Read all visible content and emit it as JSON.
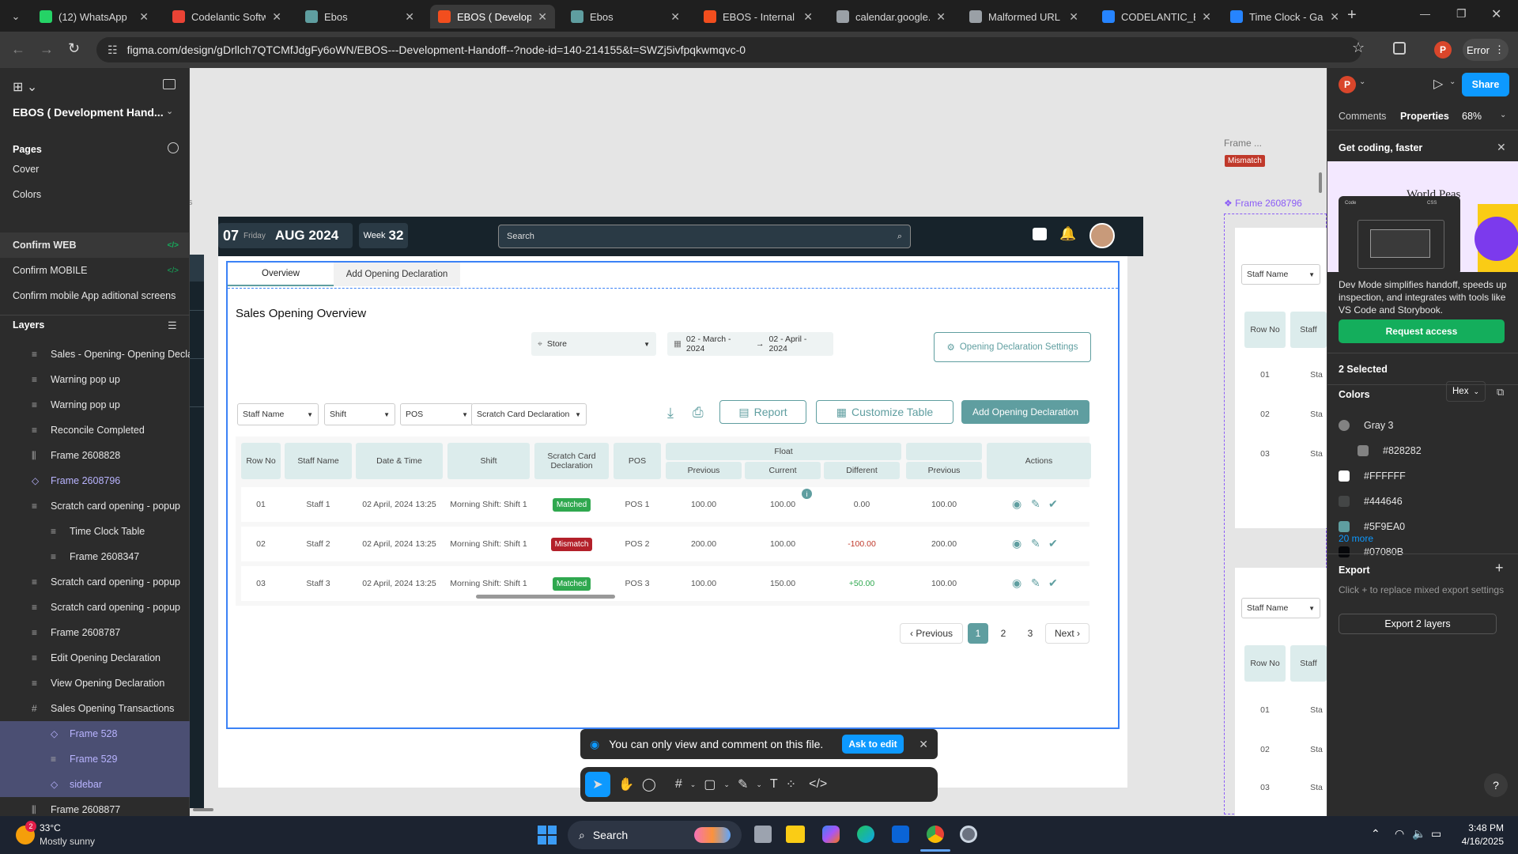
{
  "browser": {
    "tabs": [
      {
        "label": "(12) WhatsApp",
        "color": "#25d366"
      },
      {
        "label": "Codelantic Softw",
        "color": "#ea4335"
      },
      {
        "label": "Ebos",
        "color": "#5f9ea0"
      },
      {
        "label": "EBOS ( Developm",
        "color": "#f24e1e",
        "active": true
      },
      {
        "label": "Ebos",
        "color": "#5f9ea0"
      },
      {
        "label": "EBOS - Internal W",
        "color": "#f24e1e"
      },
      {
        "label": "calendar.google.c",
        "color": "#9aa0a6"
      },
      {
        "label": "Malformed URL E",
        "color": "#9aa0a6"
      },
      {
        "label": "CODELANTIC_EBC",
        "color": "#2684ff"
      },
      {
        "label": "Time Clock - Galle",
        "color": "#2684ff"
      }
    ],
    "url": "figma.com/design/gDrllch7QTCMfJdgFy6oWN/EBOS---Development-Handoff--?node-id=140-214155&t=SWZj5ivfpqkwmqvc-0",
    "profile_letter": "P",
    "error_label": "Error"
  },
  "figma": {
    "file_name": "EBOS ( Development Hand...",
    "pages_title": "Pages",
    "pages": [
      "Cover",
      "Colors",
      "Confirm WEB",
      "Confirm  MOBILE",
      "Confirm mobile App aditional screens"
    ],
    "layers_title": "Layers",
    "layers": [
      {
        "label": "Sales - Opening- Opening Declara",
        "icon": "frame",
        "indent": 0
      },
      {
        "label": "Warning pop up",
        "icon": "frame",
        "indent": 0
      },
      {
        "label": "Warning pop up",
        "icon": "frame",
        "indent": 0
      },
      {
        "label": "Reconcile Completed",
        "icon": "frame",
        "indent": 0
      },
      {
        "label": "Frame 2608828",
        "icon": "columns",
        "indent": 0
      },
      {
        "label": "Frame 2608796",
        "icon": "component",
        "indent": 0,
        "purple": true
      },
      {
        "label": "Scratch card opening - popup",
        "icon": "frame",
        "indent": 0
      },
      {
        "label": "Time Clock Table",
        "icon": "frame",
        "indent": 1
      },
      {
        "label": "Frame 2608347",
        "icon": "frame",
        "indent": 1
      },
      {
        "label": "Scratch card opening - popup",
        "icon": "frame",
        "indent": 0
      },
      {
        "label": "Scratch card opening - popup",
        "icon": "frame",
        "indent": 0
      },
      {
        "label": "Frame 2608787",
        "icon": "frame",
        "indent": 0
      },
      {
        "label": "Edit Opening Declaration",
        "icon": "frame",
        "indent": 0
      },
      {
        "label": "View Opening Declaration",
        "icon": "frame",
        "indent": 0
      },
      {
        "label": "Sales Opening Transactions",
        "icon": "hash",
        "indent": 0
      },
      {
        "label": "Frame 528",
        "icon": "component",
        "indent": 1,
        "selected": true
      },
      {
        "label": "Frame 529",
        "icon": "frame",
        "indent": 1,
        "selected": true
      },
      {
        "label": "sidebar",
        "icon": "component",
        "indent": 1,
        "selected": true
      },
      {
        "label": "Frame 2608877",
        "icon": "columns",
        "indent": 0
      }
    ],
    "canvas": {
      "frame_label_1": "Frame ...",
      "mismatch_tag": "Mismatch",
      "frame_label_2": "Frame 2608796",
      "partial_text": "s",
      "right_frame": {
        "staff_select": "Staff Name",
        "row_no": "Row No",
        "staff": "Staff",
        "rows": [
          "01",
          "02",
          "03"
        ],
        "row_prefix": "Sta"
      }
    },
    "toast": {
      "text": "You can only view and comment on this file.",
      "button": "Ask to edit"
    },
    "right_panel": {
      "tabs": [
        "Comments",
        "Properties"
      ],
      "zoom": "68%",
      "share": "Share",
      "promo_title": "Get coding, faster",
      "promo_img_text": "World Peas",
      "promo_code_label": "Code",
      "promo_css": "CSS",
      "promo_desc": "Dev Mode simplifies handoff, speeds up inspection, and integrates with tools like VS Code and Storybook.",
      "request_access": "Request access",
      "selected": "2 Selected",
      "colors_title": "Colors",
      "color_mode": "Hex",
      "colors": [
        {
          "label": "Gray 3",
          "hex": "#828282",
          "round": true
        },
        {
          "label": "#828282",
          "hex": "#828282",
          "indent": true
        },
        {
          "label": "#FFFFFF",
          "hex": "#FFFFFF"
        },
        {
          "label": "#444646",
          "hex": "#444646"
        },
        {
          "label": "#5F9EA0",
          "hex": "#5F9EA0"
        },
        {
          "label": "#07080B",
          "hex": "#07080B"
        }
      ],
      "more": "20 more",
      "export_title": "Export",
      "export_desc": "Click + to replace mixed export settings",
      "export_button": "Export 2 layers",
      "help": "?"
    }
  },
  "app": {
    "day": "07",
    "weekday": "Friday",
    "month_year": "AUG 2024",
    "week_label": "Week",
    "week_num": "32",
    "search_placeholder": "Search",
    "tabs": [
      "Overview",
      "Add Opening Declaration"
    ],
    "page_title": "Sales Opening Overview",
    "store": "Store",
    "date_from": "02 - March - 2024",
    "date_to": "02 - April - 2024",
    "settings_btn": "Opening Declaration Settings",
    "filters": [
      "Staff Name",
      "Shift",
      "POS",
      "Scratch Card Declaration"
    ],
    "report_btn": "Report",
    "customize_btn": "Customize Table",
    "add_btn": "Add Opening Declaration",
    "headers": {
      "row_no": "Row No",
      "staff_name": "Staff Name",
      "date_time": "Date & Time",
      "shift": "Shift",
      "scratch": "Scratch Card Declaration",
      "pos": "POS",
      "float": "Float",
      "previous": "Previous",
      "current": "Current",
      "different": "Different",
      "previous2": "Previous",
      "actions": "Actions"
    },
    "rows": [
      {
        "no": "01",
        "staff": "Staff 1",
        "dt": "02 April, 2024 13:25",
        "shift": "Morning Shift: Shift 1",
        "status": "Matched",
        "pos": "POS 1",
        "prev": "100.00",
        "cur": "100.00",
        "diff": "0.00",
        "prev2": "100.00"
      },
      {
        "no": "02",
        "staff": "Staff 2",
        "dt": "02 April, 2024 13:25",
        "shift": "Morning Shift: Shift 1",
        "status": "Mismatch",
        "pos": "POS 2",
        "prev": "200.00",
        "cur": "100.00",
        "diff": "-100.00",
        "prev2": "200.00"
      },
      {
        "no": "03",
        "staff": "Staff 3",
        "dt": "02 April, 2024 13:25",
        "shift": "Morning Shift: Shift 1",
        "status": "Matched",
        "pos": "POS 3",
        "prev": "100.00",
        "cur": "150.00",
        "diff": "+50.00",
        "prev2": "100.00"
      }
    ],
    "pagination": {
      "prev": "Previous",
      "pages": [
        "1",
        "2",
        "3"
      ],
      "next": "Next"
    }
  },
  "taskbar": {
    "weather_temp": "33°C",
    "weather_desc": "Mostly sunny",
    "weather_badge": "2",
    "search": "Search",
    "time": "3:48 PM",
    "date": "4/16/2025"
  }
}
